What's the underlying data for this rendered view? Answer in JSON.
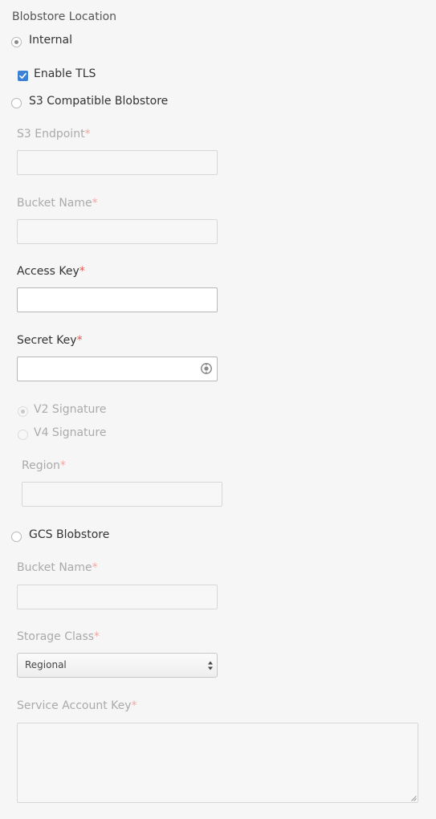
{
  "section": {
    "title": "Blobstore Location"
  },
  "internal": {
    "label": "Internal",
    "selected": true,
    "tls": {
      "label": "Enable TLS",
      "checked": true
    }
  },
  "s3": {
    "label": "S3 Compatible Blobstore",
    "selected": false,
    "endpoint_label": "S3 Endpoint",
    "bucket_label": "Bucket Name",
    "access_key_label": "Access Key",
    "secret_key_label": "Secret Key",
    "signature_options": [
      "V2 Signature",
      "V4 Signature"
    ],
    "signature_selected": "V2 Signature",
    "region_label": "Region"
  },
  "gcs": {
    "label": "GCS Blobstore",
    "selected": false,
    "bucket_label": "Bucket Name",
    "storage_class_label": "Storage Class",
    "storage_class_value": "Regional",
    "service_account_label": "Service Account Key"
  },
  "required_mark": "*",
  "colors": {
    "accent": "#3b82d6",
    "required": "#e2574c",
    "disabled_text": "#aaaaaa"
  },
  "icons": {
    "reveal_secret": "password-reveal-icon"
  }
}
